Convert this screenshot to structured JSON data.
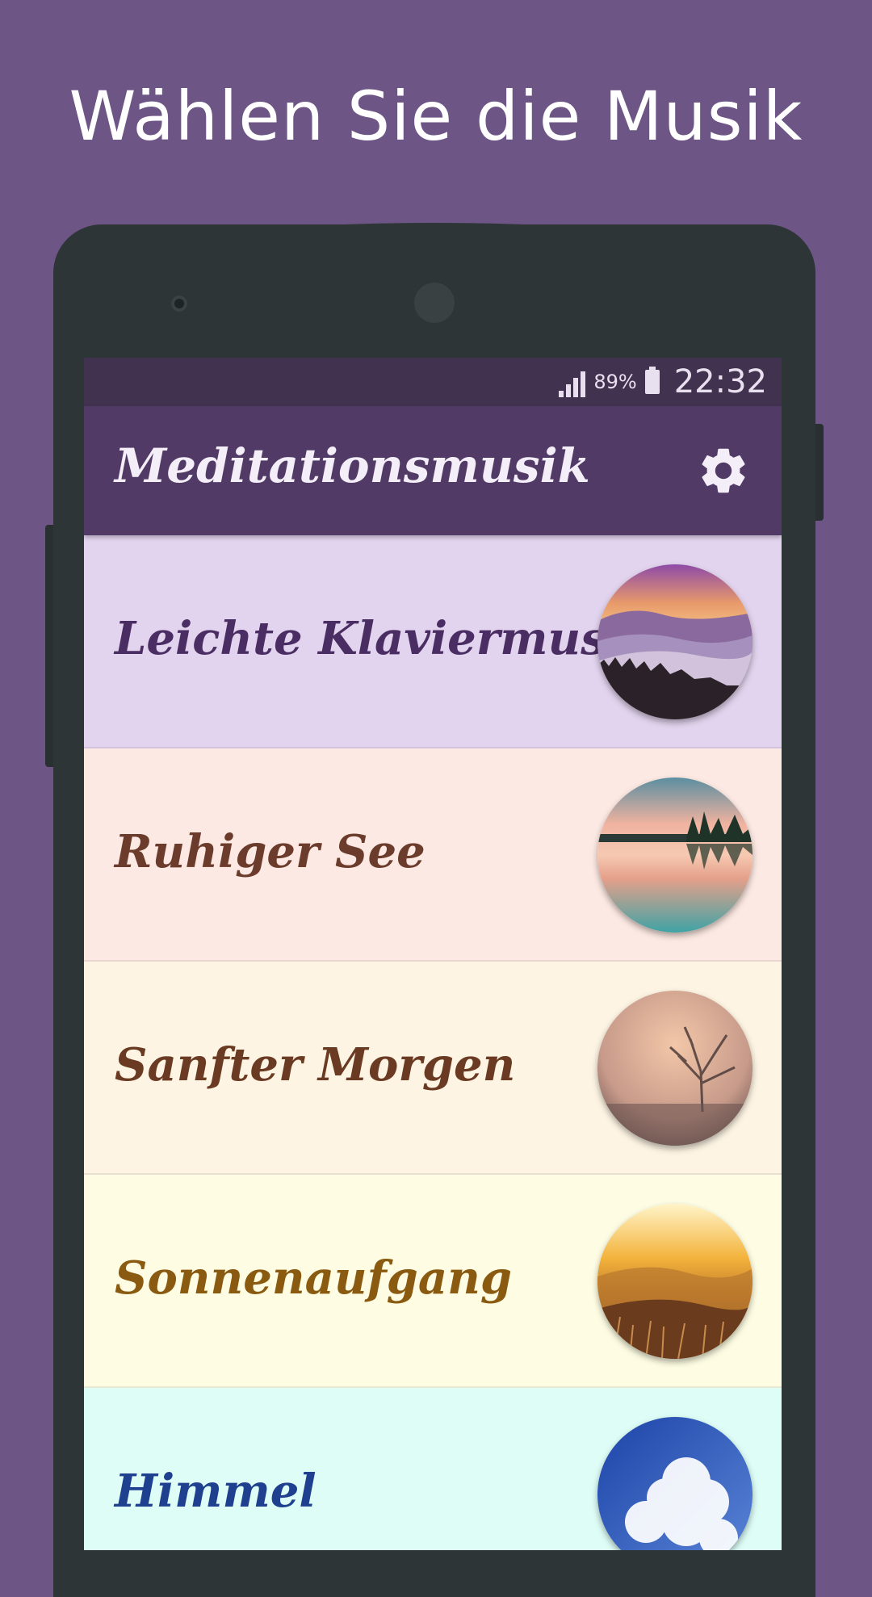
{
  "promo": {
    "title": "Wählen Sie die Musik"
  },
  "status_bar": {
    "battery_percent": "89%",
    "time": "22:32",
    "icons": [
      "signal-icon",
      "battery-icon"
    ]
  },
  "app_bar": {
    "title": "Meditationsmusik",
    "settings_icon": "gear-icon"
  },
  "tracks": [
    {
      "label": "Leichte Klaviermusik",
      "bg": "#e2d4ee",
      "color": "#4a2d62",
      "image": "mountain-sunset-image"
    },
    {
      "label": "Ruhiger See",
      "bg": "#fde9e3",
      "color": "#6b3b2c",
      "image": "calm-lake-image"
    },
    {
      "label": "Sanfter Morgen",
      "bg": "#fdf4e3",
      "color": "#6a3a22",
      "image": "misty-tree-image"
    },
    {
      "label": "Sonnenaufgang",
      "bg": "#fefde3",
      "color": "#8a5a10",
      "image": "sunrise-field-image"
    },
    {
      "label": "Himmel",
      "bg": "#ddfdf6",
      "color": "#1f3f8f",
      "image": "blue-sky-clouds-image"
    }
  ],
  "colors": {
    "background": "#6d5585",
    "phone_body": "#2e3537",
    "status_bar": "#41324f",
    "app_bar": "#523a67"
  }
}
